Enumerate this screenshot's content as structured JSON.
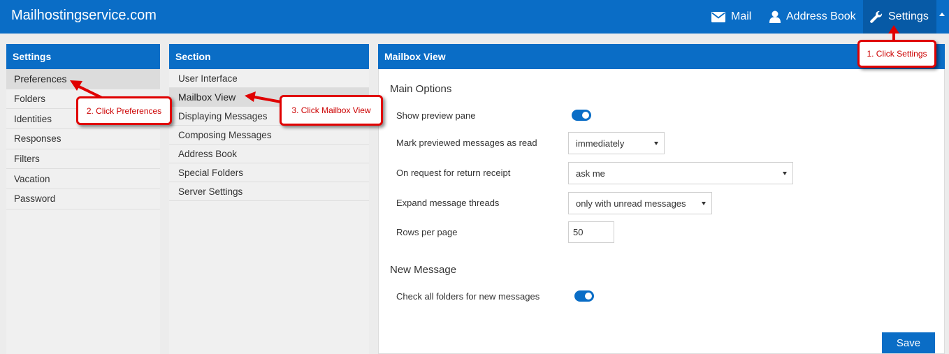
{
  "topbar": {
    "brand": "Mailhostingservice.com",
    "nav": {
      "mail": "Mail",
      "address_book": "Address Book",
      "settings": "Settings"
    }
  },
  "settings_panel": {
    "header": "Settings",
    "items": [
      "Preferences",
      "Folders",
      "Identities",
      "Responses",
      "Filters",
      "Vacation",
      "Password"
    ],
    "selected": "Preferences"
  },
  "section_panel": {
    "header": "Section",
    "items": [
      "User Interface",
      "Mailbox View",
      "Displaying Messages",
      "Composing Messages",
      "Address Book",
      "Special Folders",
      "Server Settings"
    ],
    "selected": "Mailbox View"
  },
  "main_panel": {
    "header": "Mailbox View",
    "main_options": {
      "title": "Main Options",
      "show_preview_pane": {
        "label": "Show preview pane",
        "enabled": true
      },
      "mark_previewed": {
        "label": "Mark previewed messages as read",
        "value": "immediately"
      },
      "return_receipt": {
        "label": "On request for return receipt",
        "value": "ask me"
      },
      "expand_threads": {
        "label": "Expand message threads",
        "value": "only with unread messages"
      },
      "rows_per_page": {
        "label": "Rows per page",
        "value": "50"
      }
    },
    "new_message": {
      "title": "New Message",
      "check_all_folders": {
        "label": "Check all folders for new messages",
        "enabled": true
      }
    },
    "save_label": "Save"
  },
  "annotations": {
    "step1": "1. Click Settings",
    "step2": "2. Click Preferences",
    "step3": "3. Click Mailbox View"
  },
  "colors": {
    "primary": "#0a6dc6",
    "annotation": "#e00000"
  }
}
